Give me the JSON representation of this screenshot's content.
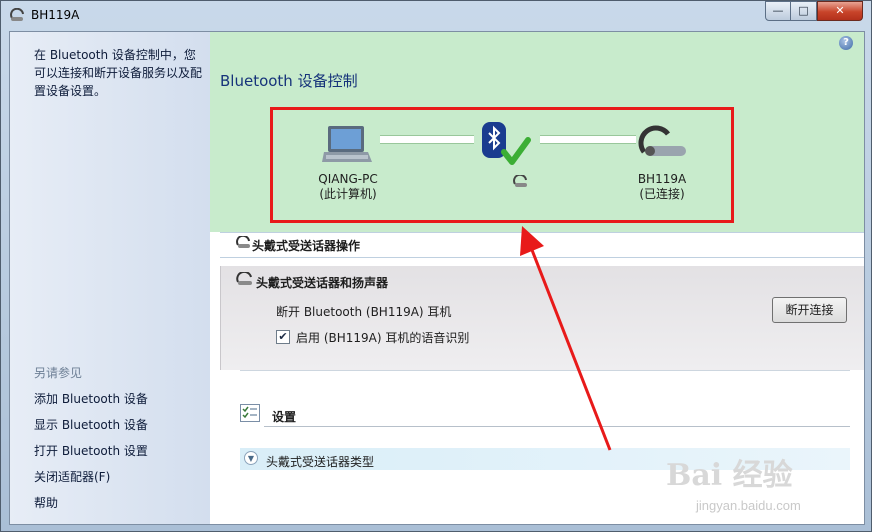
{
  "window": {
    "title": "BH119A",
    "controls": {
      "minimize": "—",
      "maximize": "□",
      "close": "✕"
    }
  },
  "sidebar": {
    "description": "在 Bluetooth 设备控制中，您可以连接和断开设备服务以及配置设备设置。",
    "see_also": "另请参见",
    "links": [
      {
        "label": "添加 Bluetooth 设备"
      },
      {
        "label": "显示 Bluetooth 设备"
      },
      {
        "label": "打开 Bluetooth 设置"
      },
      {
        "label": "关闭适配器(F)"
      },
      {
        "label": "帮助"
      }
    ]
  },
  "main": {
    "help_icon": "?",
    "title": "Bluetooth 设备控制",
    "computer": {
      "name": "QIANG-PC",
      "sub": "(此计算机)"
    },
    "device": {
      "name": "BH119A",
      "sub": "(已连接)"
    },
    "ops_header": "头戴式受送话器操作",
    "panel": {
      "title": "头戴式受送话器和扬声器",
      "disconnect_text": "断开 Bluetooth (BH119A) 耳机",
      "disconnect_button": "断开连接",
      "voice_checkbox_label": "启用 (BH119A) 耳机的语音识别",
      "voice_checked": true
    },
    "settings_title": "设置",
    "headset_type_label": "头戴式受送话器类型"
  },
  "watermark": {
    "brand": "Bai 经验",
    "url": "jingyan.baidu.com"
  },
  "colors": {
    "accent_red": "#e81a1a",
    "green_panel": "#c8ebcc",
    "title_blue": "#16337a",
    "bluetooth_blue": "#1a3c8f",
    "check_green": "#3cae35"
  }
}
